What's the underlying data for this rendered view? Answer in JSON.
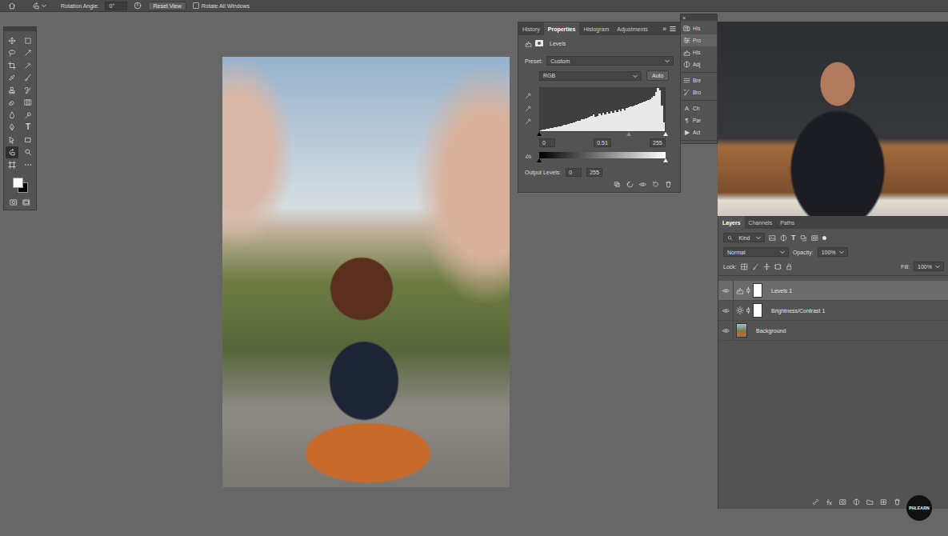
{
  "options_bar": {
    "rotation_label": "Rotation Angle:",
    "rotation_value": "0°",
    "reset_button": "Reset View",
    "rotate_all": {
      "label": "Rotate All Windows",
      "checked": false
    }
  },
  "toolbar": {
    "tools": [
      {
        "kind": "icon",
        "selected": false
      },
      {
        "kind": "icon",
        "selected": false
      },
      {
        "kind": "icon",
        "selected": false
      },
      {
        "kind": "icon",
        "selected": false
      },
      {
        "kind": "icon",
        "selected": false
      },
      {
        "kind": "icon",
        "selected": false
      },
      {
        "kind": "icon",
        "selected": false
      },
      {
        "kind": "icon",
        "selected": false
      },
      {
        "kind": "icon",
        "selected": false
      },
      {
        "kind": "icon",
        "selected": false
      },
      {
        "kind": "icon",
        "selected": false
      },
      {
        "kind": "icon",
        "selected": false
      },
      {
        "kind": "icon",
        "selected": false
      },
      {
        "kind": "icon",
        "selected": false
      },
      {
        "kind": "icon",
        "selected": false
      },
      {
        "kind": "glyph",
        "glyph": "T",
        "selected": false
      },
      {
        "kind": "icon",
        "selected": false
      },
      {
        "kind": "icon",
        "selected": false
      },
      {
        "kind": "icon",
        "selected": true
      },
      {
        "kind": "icon",
        "selected": false
      },
      {
        "kind": "icon",
        "selected": false
      },
      {
        "kind": "icon",
        "selected": false
      }
    ],
    "swatches": {
      "foreground": "#ffffff",
      "background": "#000000"
    }
  },
  "properties_panel": {
    "tabs": [
      {
        "label": "History",
        "selected": false
      },
      {
        "label": "Properties",
        "selected": true
      },
      {
        "label": "Histogram",
        "selected": false
      },
      {
        "label": "Adjustments",
        "selected": false
      }
    ],
    "overflow": "»",
    "title": "Levels",
    "preset_label": "Preset:",
    "preset_value": "Custom",
    "channel": "RGB",
    "auto_button": "Auto",
    "histogram": [
      2,
      3,
      4,
      5,
      6,
      7,
      8,
      9,
      10,
      11,
      12,
      13,
      14,
      15,
      16,
      18,
      19,
      20,
      22,
      24,
      25,
      27,
      28,
      30,
      32,
      34,
      35,
      38,
      33,
      36,
      40,
      37,
      42,
      39,
      44,
      41,
      46,
      43,
      48,
      45,
      50,
      47,
      52,
      48,
      54,
      55,
      57,
      58,
      60,
      62,
      63,
      65,
      66,
      68,
      70,
      72,
      75,
      78,
      82,
      90,
      100,
      95,
      60,
      20
    ],
    "input_sliders": [
      {
        "value": "0",
        "level": 0
      },
      {
        "value": "0.51",
        "level": 0.71
      },
      {
        "value": "255",
        "level": 1
      }
    ],
    "output_label": "Output Levels:",
    "output_sliders": [
      {
        "value": "0",
        "level": 0
      },
      {
        "value": "255",
        "level": 1
      }
    ]
  },
  "dock": {
    "close": "×",
    "groups": [
      {
        "items": [
          {
            "kind": "icon",
            "label": "His",
            "selected": false
          },
          {
            "kind": "icon",
            "label": "Pro",
            "selected": true
          },
          {
            "kind": "icon",
            "label": "His",
            "selected": false
          },
          {
            "kind": "icon",
            "label": "Adj",
            "selected": false
          }
        ]
      },
      {
        "items": [
          {
            "kind": "icon",
            "label": "Bre",
            "selected": false
          },
          {
            "kind": "icon",
            "label": "Bro",
            "selected": false
          }
        ]
      },
      {
        "items": [
          {
            "kind": "glyph",
            "glyph": "A",
            "label": "Ch",
            "selected": false
          },
          {
            "kind": "glyph",
            "glyph": "¶",
            "label": "Par",
            "selected": false
          },
          {
            "kind": "glyph",
            "glyph": "▶",
            "label": "Act",
            "selected": false
          }
        ]
      }
    ]
  },
  "layers_panel": {
    "tabs": [
      {
        "label": "Layers",
        "selected": true
      },
      {
        "label": "Channels",
        "selected": false
      },
      {
        "label": "Paths",
        "selected": false
      }
    ],
    "filter": {
      "label": "Kind",
      "type_glyph": "T"
    },
    "blend_mode": "Normal",
    "opacity_label": "Opacity:",
    "opacity_value": "100%",
    "lock_label": "Lock:",
    "fill_label": "Fill:",
    "fill_value": "100%",
    "layers": [
      {
        "name": "Levels 1",
        "kind": "levels",
        "visible": true,
        "selected": true
      },
      {
        "name": "Brightness/Contrast 1",
        "kind": "brightness",
        "visible": true,
        "selected": false
      },
      {
        "name": "Background",
        "kind": "image",
        "visible": true,
        "selected": false
      }
    ]
  },
  "watermark": {
    "text": "PHLEARN"
  }
}
